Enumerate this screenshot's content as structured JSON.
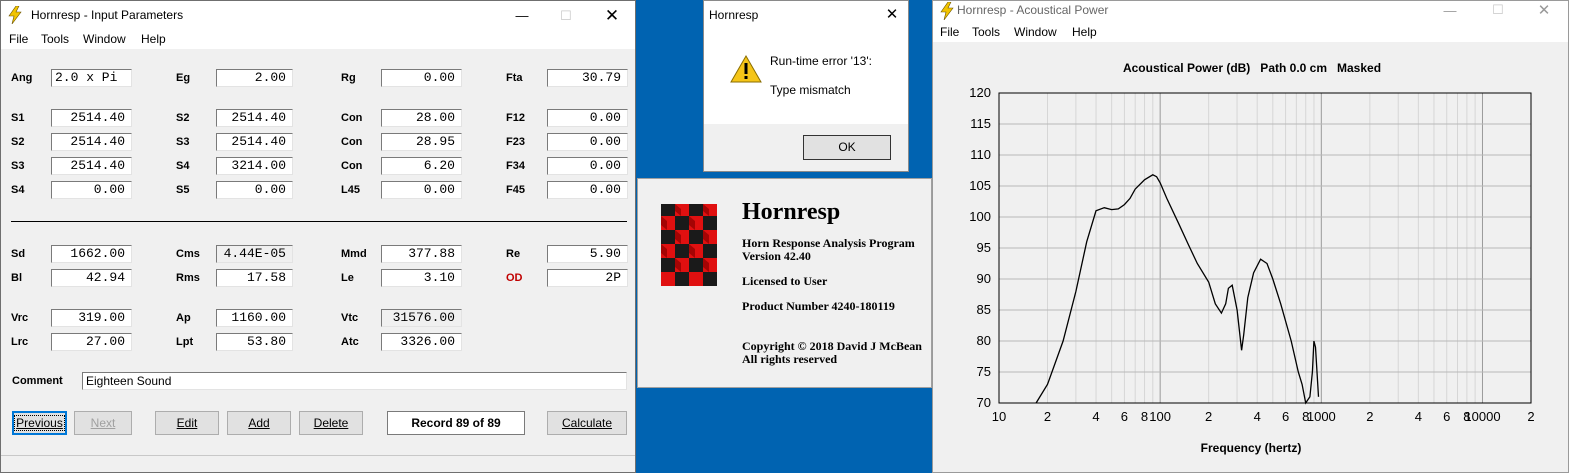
{
  "input_window": {
    "title": "Hornresp - Input Parameters",
    "menu": [
      "File",
      "Tools",
      "Window",
      "Help"
    ],
    "rows": [
      [
        {
          "label": "Ang",
          "value": "2.0 x Pi",
          "align": "left"
        },
        {
          "label": "Eg",
          "value": "2.00"
        },
        {
          "label": "Rg",
          "value": "0.00"
        },
        {
          "label": "Fta",
          "value": "30.79"
        }
      ],
      [
        {
          "label": "S1",
          "value": "2514.40"
        },
        {
          "label": "S2",
          "value": "2514.40"
        },
        {
          "label": "Con",
          "value": "28.00"
        },
        {
          "label": "F12",
          "value": "0.00"
        }
      ],
      [
        {
          "label": "S2",
          "value": "2514.40"
        },
        {
          "label": "S3",
          "value": "2514.40"
        },
        {
          "label": "Con",
          "value": "28.95"
        },
        {
          "label": "F23",
          "value": "0.00"
        }
      ],
      [
        {
          "label": "S3",
          "value": "2514.40"
        },
        {
          "label": "S4",
          "value": "3214.00"
        },
        {
          "label": "Con",
          "value": "6.20"
        },
        {
          "label": "F34",
          "value": "0.00"
        }
      ],
      [
        {
          "label": "S4",
          "value": "0.00"
        },
        {
          "label": "S5",
          "value": "0.00"
        },
        {
          "label": "L45",
          "value": "0.00"
        },
        {
          "label": "F45",
          "value": "0.00"
        }
      ],
      [
        {
          "label": "Sd",
          "value": "1662.00"
        },
        {
          "label": "Cms",
          "value": "4.44E-05",
          "grey": true
        },
        {
          "label": "Mmd",
          "value": "377.88"
        },
        {
          "label": "Re",
          "value": "5.90"
        }
      ],
      [
        {
          "label": "Bl",
          "value": "42.94"
        },
        {
          "label": "Rms",
          "value": "17.58"
        },
        {
          "label": "Le",
          "value": "3.10"
        },
        {
          "label": "OD",
          "value": "2P",
          "red": true
        }
      ],
      [
        {
          "label": "Vrc",
          "value": "319.00"
        },
        {
          "label": "Ap",
          "value": "1160.00"
        },
        {
          "label": "Vtc",
          "value": "31576.00",
          "grey": true
        }
      ],
      [
        {
          "label": "Lrc",
          "value": "27.00"
        },
        {
          "label": "Lpt",
          "value": "53.80"
        },
        {
          "label": "Atc",
          "value": "3326.00"
        }
      ]
    ],
    "comment_label": "Comment",
    "comment_value": "Eighteen Sound",
    "buttons": {
      "previous": "Previous",
      "next": "Next",
      "edit": "Edit",
      "add": "Add",
      "delete": "Delete",
      "calculate": "Calculate"
    },
    "record": "Record 89 of 89"
  },
  "error_dialog": {
    "title": "Hornresp",
    "line1": "Run-time error '13':",
    "line2": "Type mismatch",
    "ok": "OK"
  },
  "splash": {
    "title": "Hornresp",
    "subtitle": "Horn Response Analysis Program",
    "version": "Version 42.40",
    "licensed": "Licensed to User",
    "product": "Product Number 4240-180119",
    "copyright": "Copyright © 2018 David J McBean",
    "rights": "All rights reserved"
  },
  "power_window": {
    "title": "Hornresp - Acoustical Power",
    "menu": [
      "File",
      "Tools",
      "Window",
      "Help"
    ]
  },
  "chart_data": {
    "type": "line",
    "title": "Acoustical Power (dB)   Path 0.0 cm   Masked",
    "xlabel": "Frequency (hertz)",
    "ylabel": "",
    "x_scale": "log",
    "xlim": [
      10,
      20000
    ],
    "ylim": [
      70,
      120
    ],
    "y_ticks": [
      "120",
      "115",
      "110",
      "105",
      "100",
      "95",
      "90",
      "85",
      "80",
      "75",
      "70"
    ],
    "x_tick_labels": [
      "10",
      "2",
      "4",
      "6",
      "8",
      "100",
      "2",
      "4",
      "6",
      "8",
      "1000",
      "2",
      "4",
      "6",
      "8",
      "10000",
      "2"
    ],
    "grid": true,
    "color": "#000000",
    "series": [
      {
        "x": [
          17,
          20,
          25,
          30,
          35,
          40,
          45,
          50,
          55,
          60,
          65,
          70,
          80,
          90,
          95,
          100,
          110,
          130,
          150,
          170,
          200,
          220,
          240,
          255,
          265,
          280,
          300,
          320,
          330,
          350,
          380,
          420,
          460,
          500,
          560,
          650,
          720,
          760,
          800,
          850,
          880,
          900,
          920,
          940,
          960,
          1000,
          1100,
          1200,
          1300
        ],
        "y": [
          70,
          73,
          80,
          88,
          96,
          101,
          101.5,
          101.2,
          101.3,
          102,
          103,
          104.5,
          106,
          106.8,
          106.5,
          105.5,
          103,
          99,
          95.5,
          92.5,
          89.5,
          86,
          84.5,
          86,
          88.5,
          89,
          85,
          78.5,
          81,
          87,
          91,
          93.2,
          92.5,
          90,
          86,
          80,
          75,
          73,
          70,
          71,
          75,
          80,
          79,
          75,
          71,
          69.5,
          68.5,
          70.3,
          68.5
        ]
      }
    ]
  }
}
